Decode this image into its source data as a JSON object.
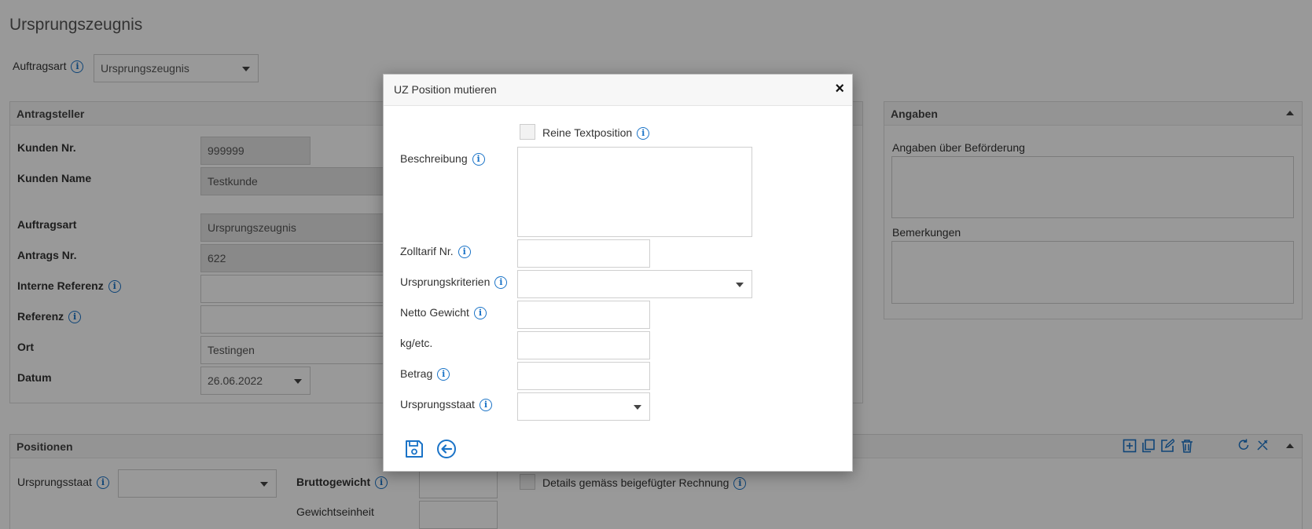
{
  "page": {
    "title": "Ursprungszeugnis",
    "auftragsart_label": "Auftragsart",
    "auftragsart_value": "Ursprungszeugnis"
  },
  "antragsteller": {
    "title": "Antragsteller",
    "fields": [
      {
        "label": "Kunden Nr.",
        "value": "999999"
      },
      {
        "label": "Kunden Name",
        "value": "Testkunde"
      },
      {
        "label": "Auftragsart",
        "value": "Ursprungszeugnis"
      },
      {
        "label": "Antrags Nr.",
        "value": "622"
      },
      {
        "label": "Interne Referenz",
        "value": ""
      },
      {
        "label": "Referenz",
        "value": ""
      },
      {
        "label": "Ort",
        "value": "Testingen"
      },
      {
        "label": "Datum",
        "value": "26.06.2022"
      }
    ]
  },
  "angaben": {
    "title": "Angaben",
    "befoerderung_label": "Angaben über Beförderung",
    "bemerkungen_label": "Bemerkungen"
  },
  "positionen": {
    "title": "Positionen",
    "ursprungsstaat_label": "Ursprungsstaat",
    "bruttogewicht_label": "Bruttogewicht",
    "gewichtseinheit_label": "Gewichtseinheit",
    "details_label": "Details gemäss beigefügter Rechnung",
    "toolbar_icons": [
      "add-icon",
      "copy-icon",
      "edit-icon",
      "delete-icon",
      "refresh-icon",
      "tools-icon"
    ]
  },
  "modal": {
    "title": "UZ Position mutieren",
    "close_glyph": "×",
    "reine_textposition_label": "Reine Textposition",
    "beschreibung_label": "Beschreibung",
    "zolltarif_label": "Zolltarif Nr.",
    "ursprungskriterien_label": "Ursprungskriterien",
    "netto_gewicht_label": "Netto Gewicht",
    "kg_label": "kg/etc.",
    "betrag_label": "Betrag",
    "ursprungsstaat_label": "Ursprungsstaat",
    "buttons": [
      "save-icon",
      "back-icon"
    ]
  },
  "colors": {
    "accent": "#1a73c7",
    "overlay": "rgba(0,0,0,0.40)"
  }
}
